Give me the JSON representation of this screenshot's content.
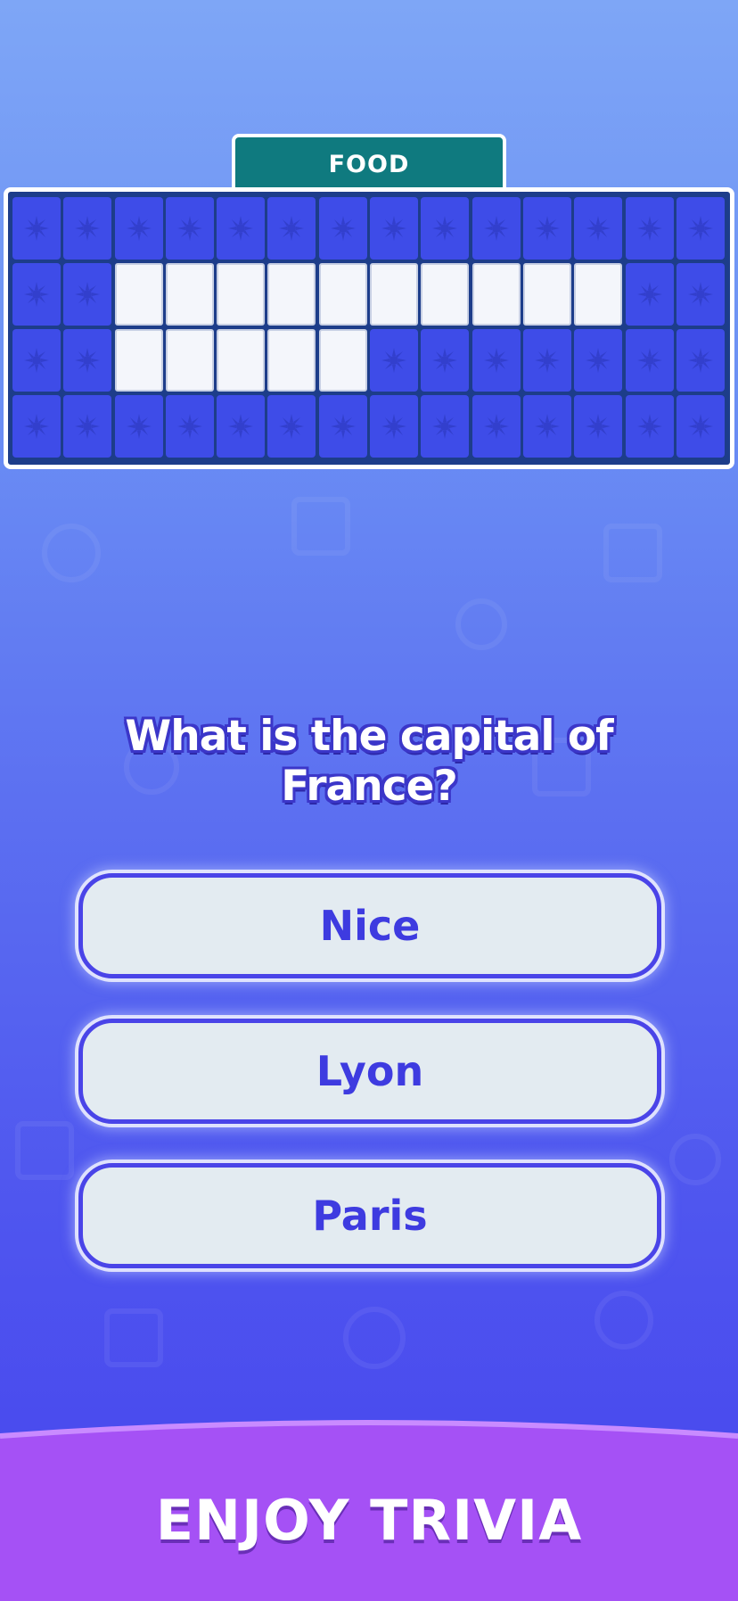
{
  "category": "FOOD",
  "board": {
    "rows": [
      [
        "",
        "",
        "",
        "",
        "",
        "",
        "",
        "",
        "",
        "",
        "",
        "",
        "",
        ""
      ],
      [
        "",
        "",
        "_",
        "_",
        "_",
        "_",
        "_",
        "_",
        "_",
        "_",
        "_",
        "_",
        "",
        ""
      ],
      [
        "",
        "",
        "_",
        "_",
        "_",
        "_",
        "_",
        "",
        "",
        "",
        "",
        "",
        "",
        ""
      ],
      [
        "",
        "",
        "",
        "",
        "",
        "",
        "",
        "",
        "",
        "",
        "",
        "",
        "",
        ""
      ]
    ]
  },
  "question": "What is the capital of France?",
  "answers": [
    {
      "label": "Nice"
    },
    {
      "label": "Lyon"
    },
    {
      "label": "Paris"
    }
  ],
  "footer": {
    "banner_text": "ENJOY TRIVIA"
  },
  "colors": {
    "tab": "#0f7a7f",
    "board_frame": "#1d3d8a",
    "blank_tile": "#3e4ce8",
    "letter_tile": "#f4f6fb",
    "answer_text": "#3e3be0",
    "footer": "#a551f5"
  }
}
